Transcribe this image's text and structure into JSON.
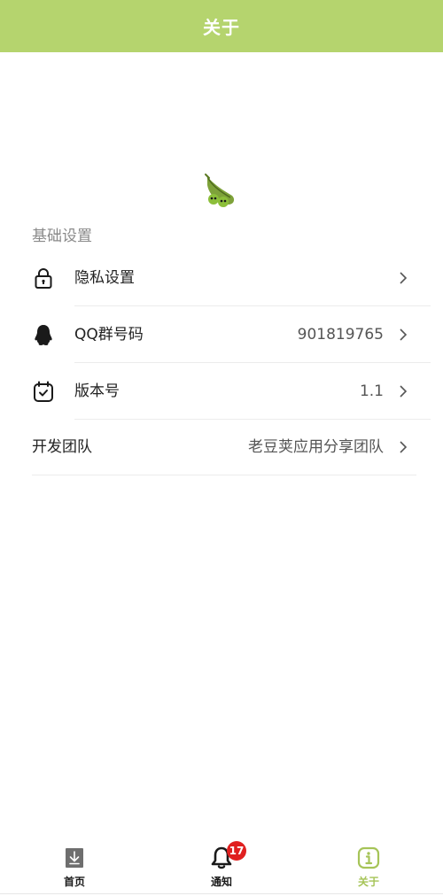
{
  "header": {
    "title": "关于"
  },
  "section": {
    "title": "基础设置"
  },
  "rows": [
    {
      "label": "隐私设置",
      "value": "",
      "icon": "lock-icon"
    },
    {
      "label": "QQ群号码",
      "value": "901819765",
      "icon": "qq-penguin-icon"
    },
    {
      "label": "版本号",
      "value": "1.1",
      "icon": "calendar-check-icon"
    },
    {
      "label": "开发团队",
      "value": "老豆荚应用分享团队",
      "icon": ""
    }
  ],
  "bottom_nav": {
    "items": [
      {
        "label": "首页",
        "icon": "download-icon",
        "active": false
      },
      {
        "label": "通知",
        "icon": "bell-icon",
        "active": false,
        "badge": "17"
      },
      {
        "label": "关于",
        "icon": "info-icon",
        "active": true
      }
    ]
  },
  "colors": {
    "header_bg": "#b5d46e",
    "active_tab": "#a6c458",
    "badge": "#e02020"
  }
}
